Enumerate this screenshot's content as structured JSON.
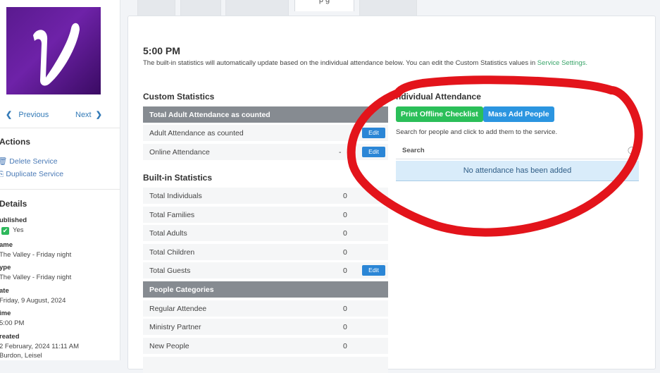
{
  "sidebar": {
    "pager": {
      "prev_label": "Previous",
      "next_label": "Next"
    },
    "actions": {
      "title": "Actions",
      "items": [
        {
          "label": "Delete Service"
        },
        {
          "label": "Duplicate Service"
        }
      ]
    },
    "details": {
      "title": "Details",
      "published_label": "ublished",
      "published_value": "Yes",
      "name_label": "ame",
      "name_value": "The Valley - Friday night",
      "type_label": "ype",
      "type_value": "The Valley - Friday night",
      "date_label": "ate",
      "date_value": "Friday, 9 August, 2024",
      "time_label": "ime",
      "time_value": "5:00 PM",
      "created_label": "reated",
      "created_value": "2 February, 2024 11:11 AM",
      "created_by": "Burdon, Leisel"
    }
  },
  "tabs": {
    "active_label": "p    g"
  },
  "main": {
    "time": "5:00 PM",
    "intro_text": "The built-in statistics will automatically update based on the individual attendance below. You can edit the Custom Statistics values in ",
    "intro_link": "Service Settings.",
    "custom_statistics": {
      "title": "Custom Statistics",
      "header": "Total Adult Attendance as counted",
      "rows": [
        {
          "label": "Adult Attendance as counted",
          "value": "",
          "edit": "Edit"
        },
        {
          "label": "Online Attendance",
          "value": "-",
          "edit": "Edit"
        }
      ]
    },
    "builtin_statistics": {
      "title": "Built-in Statistics",
      "rows": [
        {
          "label": "Total Individuals",
          "value": "0"
        },
        {
          "label": "Total Families",
          "value": "0"
        },
        {
          "label": "Total Adults",
          "value": "0"
        },
        {
          "label": "Total Children",
          "value": "0"
        },
        {
          "label": "Total Guests",
          "value": "0",
          "edit": "Edit"
        }
      ]
    },
    "people_categories": {
      "header": "People Categories",
      "rows": [
        {
          "label": "Regular Attendee",
          "value": "0"
        },
        {
          "label": "Ministry Partner",
          "value": "0"
        },
        {
          "label": "New People",
          "value": "0"
        }
      ]
    },
    "individual_attendance": {
      "title": "ndividual Attendance",
      "print_button": "Print Offline Checklist",
      "mass_add_button": "Mass Add People",
      "hint": "Search for people and click to add them to the service.",
      "search_placeholder": "Search",
      "empty_message": "No attendance has been added"
    }
  },
  "colors": {
    "green_button": "#2bbf59",
    "blue_button": "#2b95e0",
    "table_header": "#868b91",
    "annotation_ring": "#e3141b",
    "logo_purple": "#5a1a8f"
  }
}
